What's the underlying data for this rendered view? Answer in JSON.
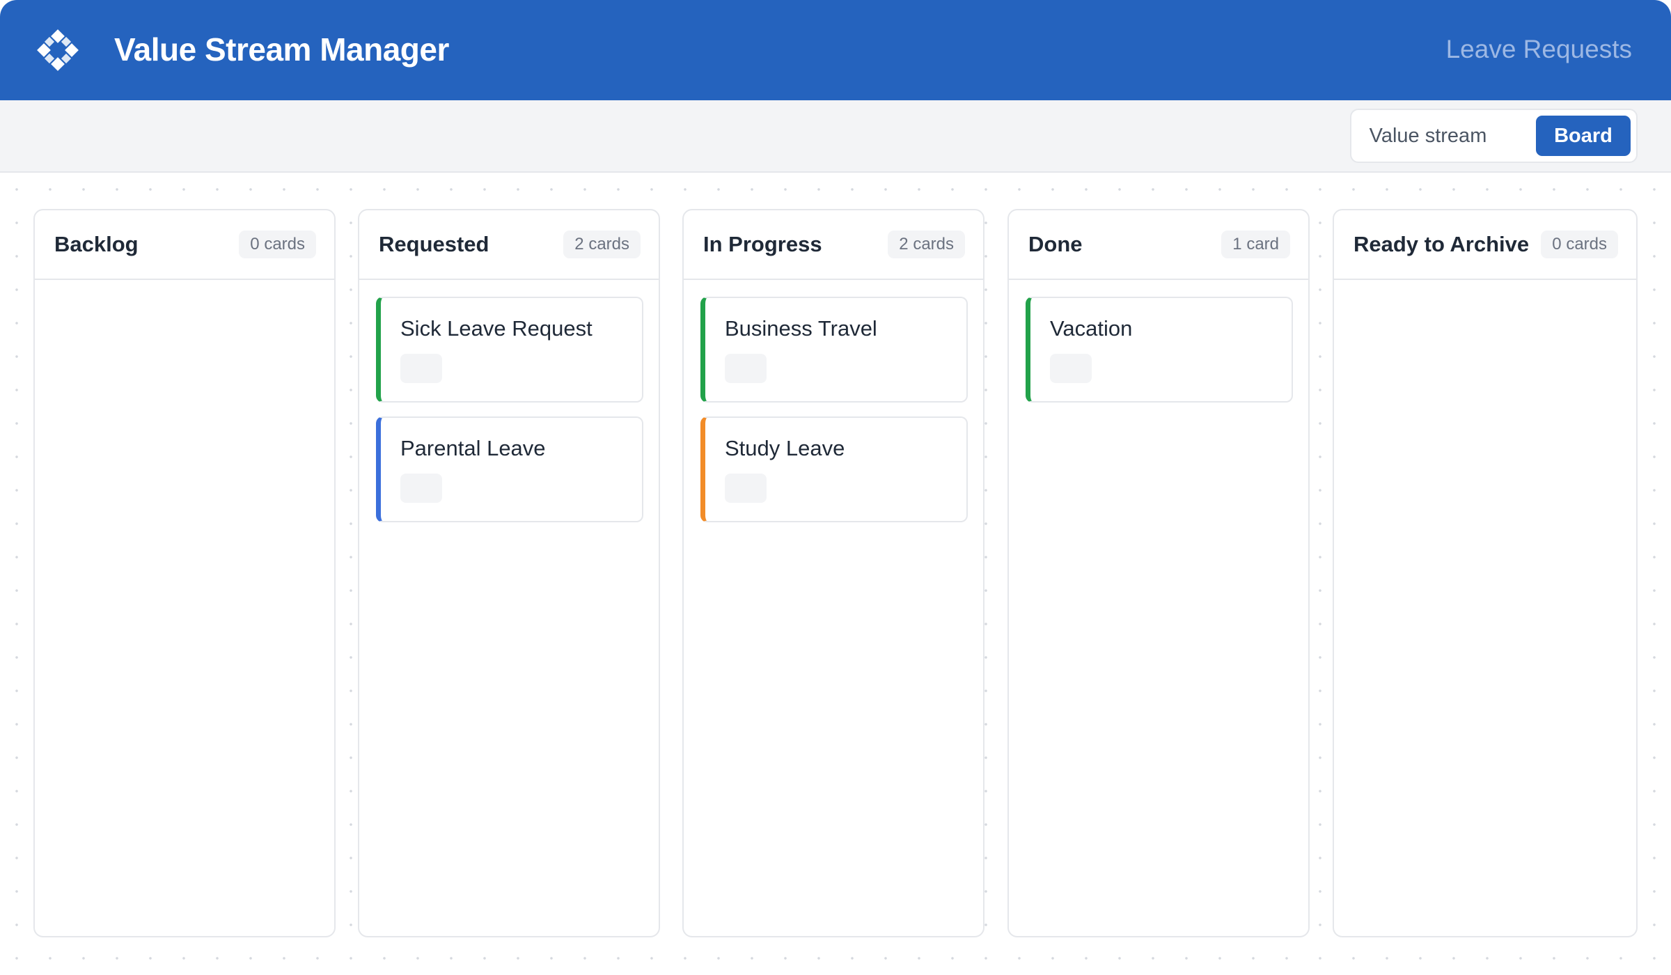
{
  "header": {
    "logo_icon": "diamond-grid-icon",
    "title": "Value Stream Manager",
    "page_name": "Leave Requests",
    "background": "#2563BE"
  },
  "toolbar": {
    "view_options": [
      "Value stream",
      "Board"
    ],
    "selected_view": "Board"
  },
  "columns": [
    {
      "title": "Backlog",
      "count_label": "0 cards",
      "cards": []
    },
    {
      "title": "Requested",
      "count_label": "2 cards",
      "cards": [
        {
          "title": "Sick Leave Request",
          "accent": "#22A24A"
        },
        {
          "title": "Parental Leave",
          "accent": "#3B6FDB"
        }
      ]
    },
    {
      "title": "In Progress",
      "count_label": "2 cards",
      "cards": [
        {
          "title": "Business Travel",
          "accent": "#22A24A"
        },
        {
          "title": "Study Leave",
          "accent": "#F28C28"
        }
      ]
    },
    {
      "title": "Done",
      "count_label": "1 card",
      "cards": [
        {
          "title": "Vacation",
          "accent": "#22A24A"
        }
      ]
    },
    {
      "title": "Ready to Archive",
      "count_label": "0 cards",
      "cards": []
    }
  ]
}
